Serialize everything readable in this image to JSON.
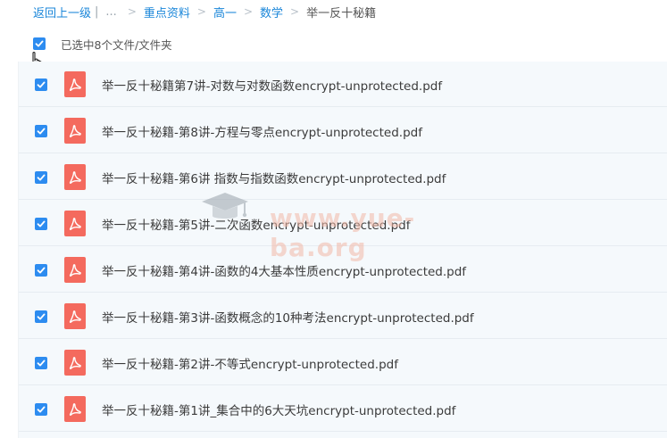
{
  "breadcrumb": {
    "back": "返回上一级",
    "ellipsis": "...",
    "items": [
      "重点资料",
      "高一",
      "数学"
    ],
    "current": "举一反十秘籍"
  },
  "selection": {
    "label": "已选中8个文件/文件夹"
  },
  "files": [
    "举一反十秘籍第7讲-对数与对数函数encrypt-unprotected.pdf",
    "举一反十秘籍-第8讲-方程与零点encrypt-unprotected.pdf",
    "举一反十秘籍-第6讲 指数与指数函数encrypt-unprotected.pdf",
    "举一反十秘籍-第5讲-二次函数encrypt-unprotected.pdf",
    "举一反十秘籍-第4讲-函数的4大基本性质encrypt-unprotected.pdf",
    "举一反十秘籍-第3讲-函数概念的10种考法encrypt-unprotected.pdf",
    "举一反十秘籍-第2讲-不等式encrypt-unprotected.pdf",
    "举一反十秘籍-第1讲_集合中的6大天坑encrypt-unprotected.pdf"
  ],
  "watermark": {
    "text": "www.yue-ba.org"
  },
  "colors": {
    "accent": "#2d8cf0",
    "link": "#1a86d9",
    "pdf": "#f46a5e"
  }
}
